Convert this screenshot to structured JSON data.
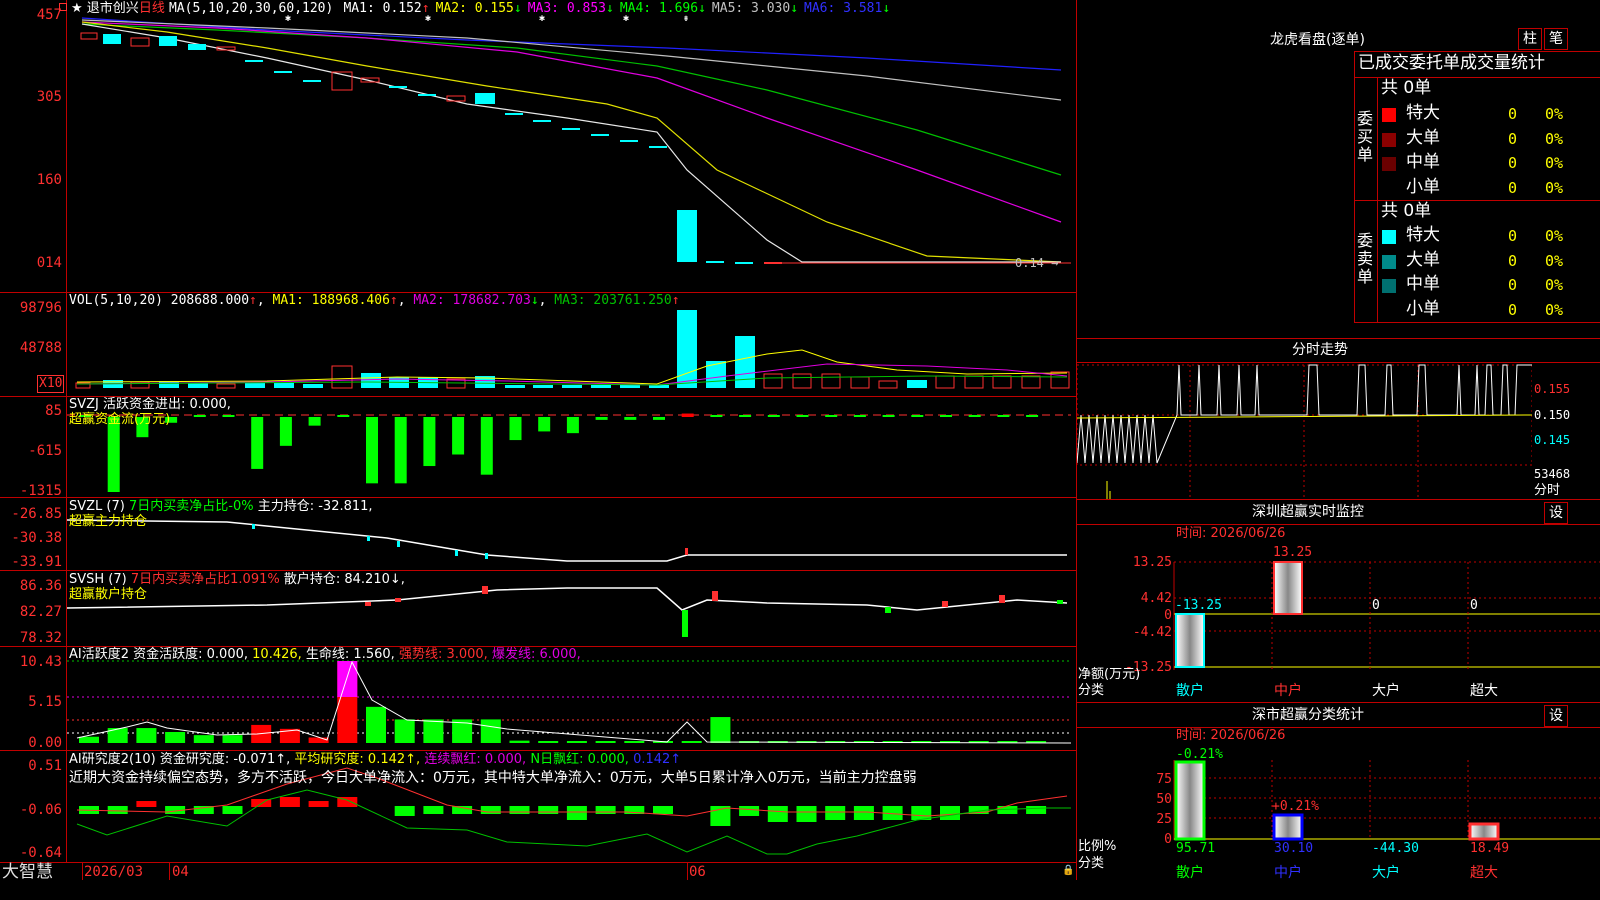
{
  "left_axis": {
    "price": [
      "457",
      "305",
      "160",
      "014"
    ],
    "vol": [
      "98796",
      "48788",
      "X10"
    ],
    "svzj": [
      "85",
      "-615",
      "-1315"
    ],
    "svzl": [
      "-26.85",
      "-30.38",
      "-33.91"
    ],
    "svsh": [
      "86.36",
      "82.27",
      "78.32"
    ],
    "ai1": [
      "10.43",
      "5.15",
      "0.00"
    ],
    "ai2": [
      "0.51",
      "-0.06",
      "-0.64"
    ],
    "bottom_logo": "大智慧"
  },
  "price_panel": {
    "stock_name": "退市创兴",
    "period": "日线",
    "ma_label": "MA(5,10,20,30,60,120)",
    "ma": [
      {
        "label": "MA1:",
        "value": "0.152",
        "arrow": "↑",
        "color": "#ffffff"
      },
      {
        "label": "MA2:",
        "value": "0.155",
        "arrow": "↓",
        "color": "#ffff00"
      },
      {
        "label": "MA3:",
        "value": "0.853",
        "arrow": "↓",
        "color": "#ff00ff"
      },
      {
        "label": "MA4:",
        "value": "1.696",
        "arrow": "↓",
        "color": "#00ff00"
      },
      {
        "label": "MA5:",
        "value": "3.030",
        "arrow": "↓",
        "color": "#c0c0c0"
      },
      {
        "label": "MA6:",
        "value": "3.581",
        "arrow": "↓",
        "color": "#3030ff"
      }
    ],
    "last_price_tag": "0.14"
  },
  "vol_panel": {
    "label": "VOL(5,10,20)",
    "value": "208688.000",
    "ma1": "MA1: 188968.406",
    "ma2": "MA2: 178682.703",
    "ma3": "MA3: 203761.250"
  },
  "svzj_panel": {
    "title": "SVZJ  活跃资金进出: 0.000,",
    "subtitle": "超赢资金流(万元)"
  },
  "svzl_panel": {
    "name": "SVZL (7)",
    "desc": "7日内买卖净占比-0%",
    "hold": "主力持仓: -32.811,",
    "subtitle": "超赢主力持仓"
  },
  "svsh_panel": {
    "name": "SVSH (7)",
    "desc": "7日内买卖净占比1.091%",
    "hold": "散户持仓: 84.210↓,",
    "subtitle": "超赢散户持仓"
  },
  "ai1_panel": {
    "name": "AI活跃度2",
    "fund": "资金活跃度: 0.000,",
    "v1": "10.426,",
    "life": "生命线: 1.560,",
    "strong": "强势线: 3.000,",
    "burst": "爆发线: 6.000,"
  },
  "ai2_panel": {
    "name": "AI研究度2(10)",
    "fund": "资金研究度: -0.071↑,",
    "avg": "平均研究度: 0.142↑,",
    "cont": "连续飘红: 0.000,",
    "nday": "N日飘红: 0.000,",
    "v": "0.142↑",
    "summary": "近期大资金持续偏空态势，多方不活跃，今日大单净流入：0万元，其中特大单净流入：0万元，大单5日累计净入0万元，当前主力控盘弱"
  },
  "date_axis": [
    "2026/03",
    "04",
    "06"
  ],
  "right_panel": {
    "dragon_title": "龙虎看盘(逐单)",
    "tabs": [
      "柱",
      "笔"
    ],
    "stats_header": "已成交委托单成交量统计",
    "buy": {
      "side_label": "委买单",
      "total": "共 0单",
      "rows": [
        {
          "name": "特大",
          "count": "0",
          "pct": "0%",
          "color": "#ff0000"
        },
        {
          "name": "大单",
          "count": "0",
          "pct": "0%",
          "color": "#8b0000"
        },
        {
          "name": "中单",
          "count": "0",
          "pct": "0%",
          "color": "#6a0000"
        },
        {
          "name": "小单",
          "count": "0",
          "pct": "0%",
          "color": ""
        }
      ]
    },
    "sell": {
      "side_label": "委卖单",
      "total": "共 0单",
      "rows": [
        {
          "name": "特大",
          "count": "0",
          "pct": "0%",
          "color": "#00ffff"
        },
        {
          "name": "大单",
          "count": "0",
          "pct": "0%",
          "color": "#008b8b"
        },
        {
          "name": "中单",
          "count": "0",
          "pct": "0%",
          "color": "#007070"
        },
        {
          "name": "小单",
          "count": "0",
          "pct": "0%",
          "color": ""
        }
      ]
    },
    "intraday": {
      "title": "分时走势",
      "prices": [
        "0.155",
        "0.150",
        "0.145"
      ],
      "vol": "53468",
      "time_label": "分时"
    },
    "monitor": {
      "title": "深圳超赢实时监控",
      "set": "设",
      "time": "时间: 2026/06/26",
      "yticks": [
        "13.25",
        "4.42",
        "0",
        "-4.42",
        "-13.25"
      ],
      "ylabel": "净额(万元)",
      "xlabel": "分类",
      "categories": [
        "散户",
        "中户",
        "大户",
        "超大"
      ],
      "values": [
        "-13.25",
        "13.25",
        "0",
        "0"
      ]
    },
    "classify": {
      "title": "深市超赢分类统计",
      "set": "设",
      "time": "时间: 2026/06/26",
      "yticks": [
        "75",
        "50",
        "25",
        "0"
      ],
      "ylabel": "比例%",
      "xlabel": "分类",
      "categories": [
        "散户",
        "中户",
        "大户",
        "超大"
      ],
      "top_labels": [
        "-0.21%",
        "+0.21%",
        "",
        ""
      ],
      "bottom_values": [
        "95.71",
        "30.10",
        "-44.30",
        "18.49"
      ]
    }
  },
  "chart_data": [
    {
      "type": "bar",
      "title": "超赢资金流(万元)",
      "ylim": [
        -1315,
        85
      ],
      "values": [
        0,
        -1300,
        -350,
        -100,
        0,
        0,
        -900,
        -500,
        -150,
        0,
        -1150,
        -1150,
        -850,
        -650,
        -1000,
        -400,
        -250,
        -280,
        -50,
        -50,
        -50,
        60,
        0,
        0,
        0,
        0,
        0,
        0,
        0,
        0,
        0,
        0,
        0,
        0
      ]
    },
    {
      "type": "bar",
      "title": "AI活跃度2",
      "ylim": [
        0,
        10.43
      ],
      "values": [
        0.8,
        1.9,
        1.9,
        1.4,
        1.0,
        1.0,
        2.3,
        1.8,
        0.7,
        10.43,
        4.6,
        3.0,
        3.0,
        3.0,
        3.0,
        0.3,
        0.2,
        0.2,
        0.1,
        0.1,
        0.1,
        0.1,
        3.3,
        0.1,
        0.1,
        0.1,
        0.1,
        0.1,
        0.1,
        0.1,
        0.1,
        0.1,
        0.1,
        0.1
      ]
    }
  ]
}
